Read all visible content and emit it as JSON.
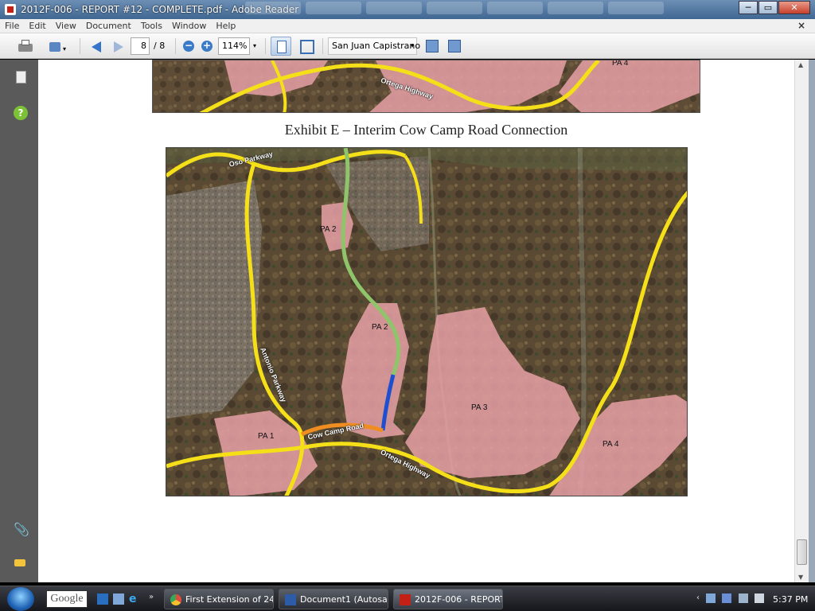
{
  "window": {
    "title": "2012F-006 - REPORT #12 - COMPLETE.pdf - Adobe Reader",
    "minimize": "─",
    "maximize": "▭",
    "close": "✕"
  },
  "menu": {
    "items": [
      "File",
      "Edit",
      "View",
      "Document",
      "Tools",
      "Window",
      "Help"
    ],
    "close_doc": "×"
  },
  "toolbar": {
    "page_current": "8",
    "page_total": "/ 8",
    "zoom_out": "−",
    "zoom_in": "+",
    "zoom": "114%",
    "search_value": "San Juan Capistrano",
    "dropdown_arrow": "▾"
  },
  "nav_pane": {
    "help_glyph": "?",
    "attach_glyph": "📎"
  },
  "document": {
    "exhibit_title": "Exhibit E – Interim Cow Camp Road Connection",
    "top_map": {
      "labels": [
        "PA 4"
      ],
      "roads": [
        "Ortega Highway"
      ]
    },
    "main_map": {
      "area_labels": [
        "PA 2",
        "PA 2",
        "PA 1",
        "PA 3",
        "PA 4"
      ],
      "road_labels": [
        "Oso Parkway",
        "Antonio Parkway",
        "Cow Camp Road",
        "Ortega Highway"
      ]
    },
    "colors": {
      "planning_area": "#e6a0a6",
      "highway": "#f4df19",
      "interim_connection": "#8fc46a",
      "blue_segment": "#1d4fd0",
      "orange_segment": "#ef8d21"
    }
  },
  "scrollbar": {
    "up": "▲",
    "down": "▼"
  },
  "taskbar": {
    "search_label": "Google",
    "chevron": "»",
    "ql3": "e",
    "buttons": [
      "First Extension of 24...",
      "Document1 (Autosa...",
      "2012F-006 - REPORT..."
    ],
    "tray_arrow": "‹",
    "clock": "5:37 PM"
  }
}
